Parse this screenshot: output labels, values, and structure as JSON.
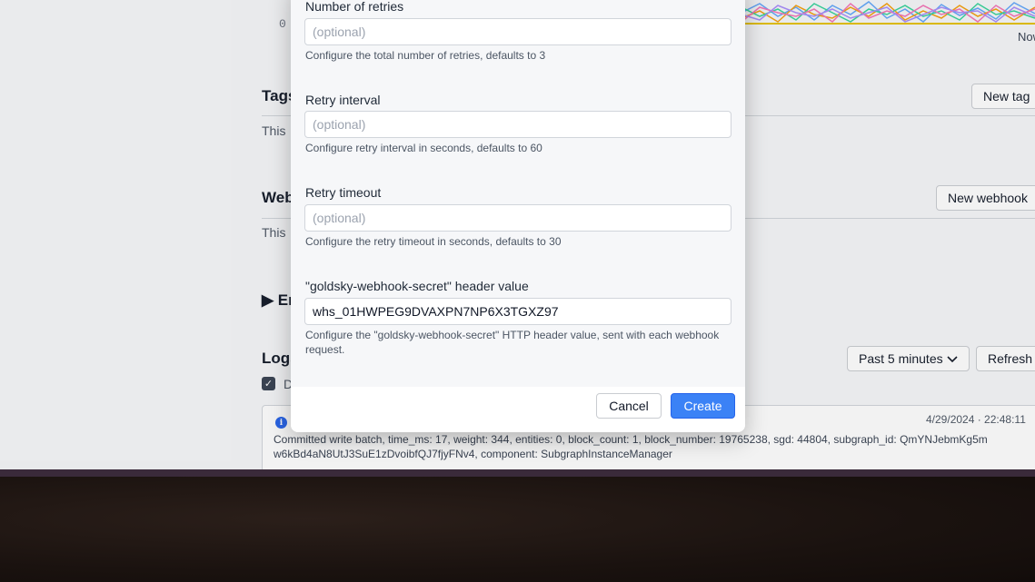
{
  "background": {
    "chart_zero": "0",
    "chart_now": "Now",
    "tags": {
      "title": "Tags",
      "new_button": "New tag",
      "empty_text": "This"
    },
    "webhooks": {
      "title": "Webhooks",
      "new_button": "New webhook",
      "empty_text": "This"
    },
    "env": {
      "title": "▶ En"
    },
    "logs": {
      "title": "Logs",
      "range_select": "Past 5 minutes",
      "refresh_button": "Refresh",
      "checkbox_label": "D",
      "entry": {
        "time": "4/29/2024 · 22:48:11",
        "message": "Committed write batch, time_ms: 17, weight: 344, entities: 0, block_count: 1, block_number: 19765238, sgd: 44804, subgraph_id: QmYNJebmKg5m w6kBd4aN8UtJ3SuE1zDvoibfQJ7fjyFNv4, component: SubgraphInstanceManager"
      }
    }
  },
  "modal": {
    "retries": {
      "label": "Number of retries",
      "placeholder": "(optional)",
      "help": "Configure the total number of retries, defaults to 3"
    },
    "retry_interval": {
      "label": "Retry interval",
      "placeholder": "(optional)",
      "help": "Configure retry interval in seconds, defaults to 60"
    },
    "retry_timeout": {
      "label": "Retry timeout",
      "placeholder": "(optional)",
      "help": "Configure the retry timeout in seconds, defaults to 30"
    },
    "secret": {
      "label": "\"goldsky-webhook-secret\" header value",
      "value": "whs_01HWPEG9DVAXPN7NP6X3TGXZ97",
      "help": "Configure the \"goldsky-webhook-secret\" HTTP header value, sent with each webhook request."
    },
    "cancel_label": "Cancel",
    "create_label": "Create"
  },
  "colors": {
    "accent": "#3b82f6",
    "background": "#f6f7f9"
  }
}
